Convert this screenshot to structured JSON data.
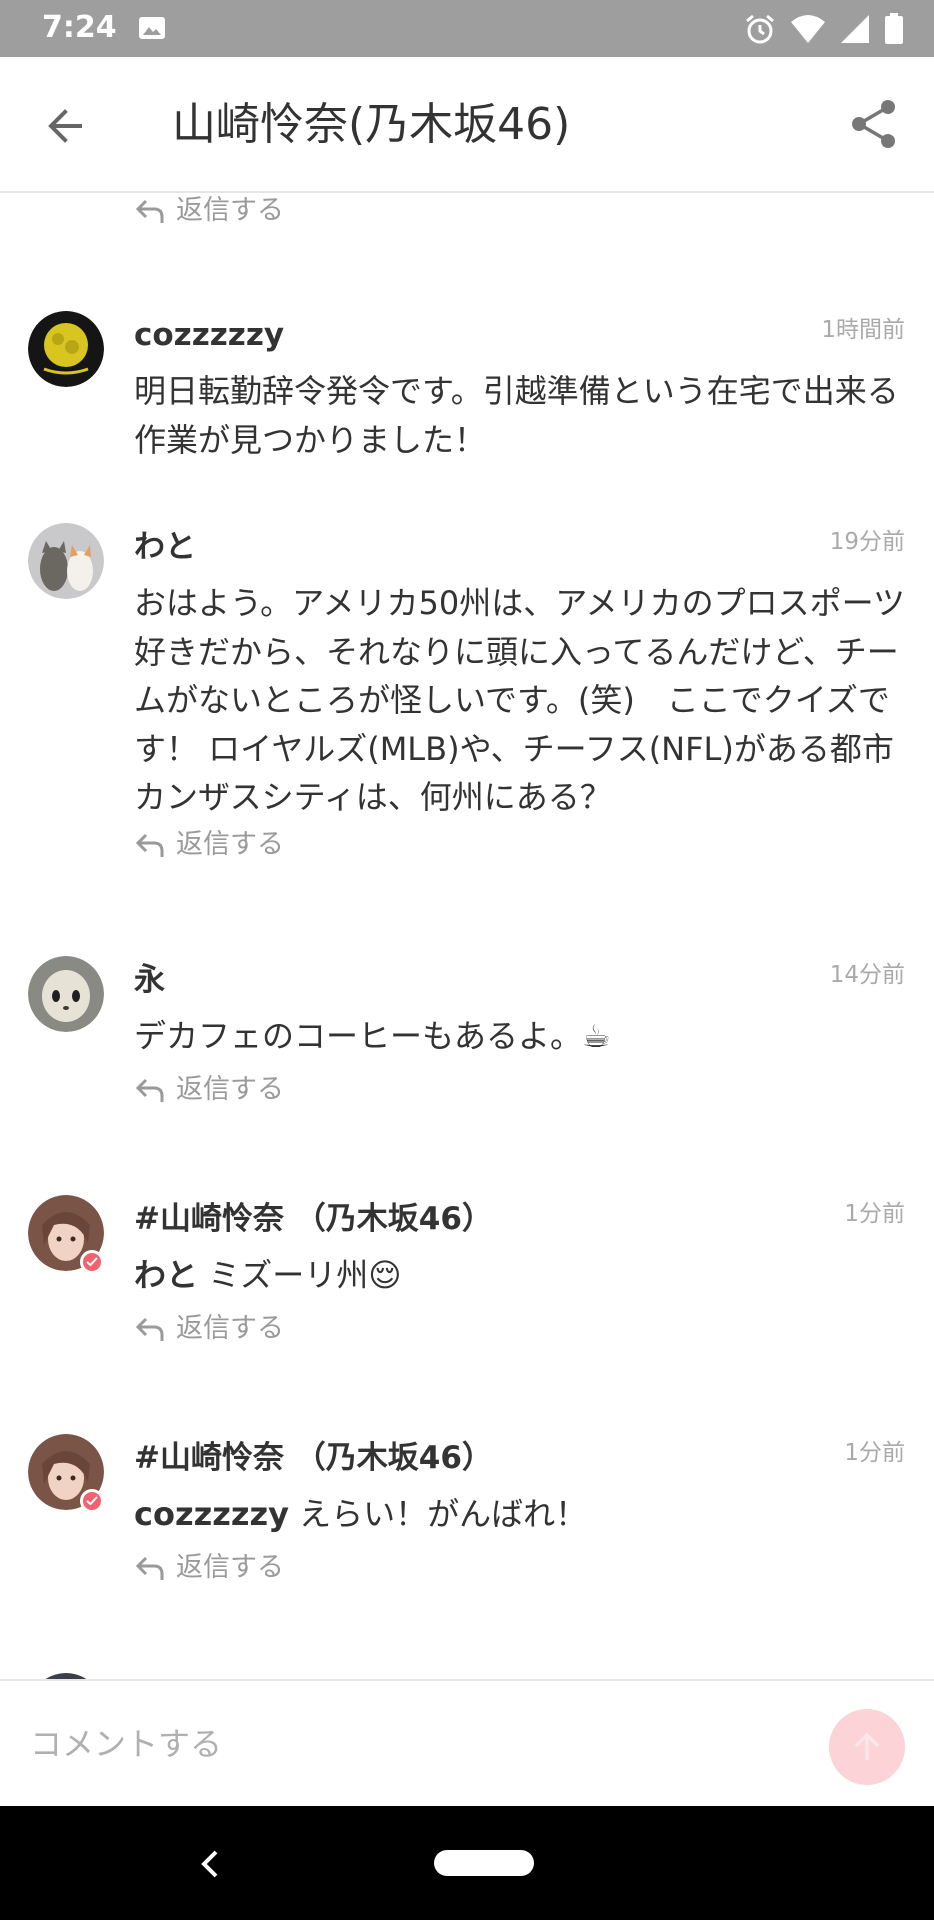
{
  "status_bar": {
    "time": "7:24",
    "bg_color": "#9e9e9e"
  },
  "header": {
    "title": "山崎怜奈(乃木坂46)"
  },
  "reply_label": "返信する",
  "comments": [
    {
      "name": "cozzzzzy",
      "time": "1時間前",
      "body": "明日転勤辞令発令です。引越準備という在宅で出来る作業が見つかりました！"
    },
    {
      "name": "わと",
      "time": "19分前",
      "body": "おはよう。アメリカ50州は、アメリカのプロスポーツ好きだから、それなりに頭に入ってるんだけど、チームがないところが怪しいです。(笑)　ここでクイズです！ ロイヤルズ(MLB)や、チーフス(NFL)がある都市カンザスシティは、何州にある？"
    },
    {
      "name": "永",
      "time": "14分前",
      "body": "デカフェのコーヒーもあるよ。☕"
    },
    {
      "name": "#山崎怜奈 （乃木坂46）",
      "time": "1分前",
      "mention": "わと",
      "body": " ミズーリ州😌"
    },
    {
      "name": "#山崎怜奈 （乃木坂46）",
      "time": "1分前",
      "mention": "cozzzzzy",
      "body": " えらい！がんばれ！"
    }
  ],
  "input": {
    "placeholder": "コメントする"
  },
  "colors": {
    "accent": "#f06270",
    "send_disabled": "#fcd3d6"
  }
}
